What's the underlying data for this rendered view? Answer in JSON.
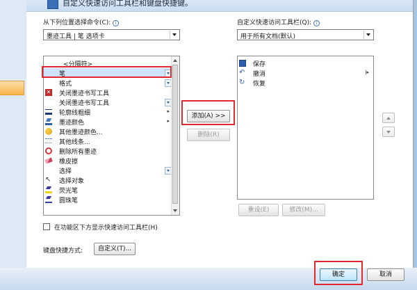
{
  "dialog": {
    "title": "自定义快速访问工具栏和键盘快捷键。"
  },
  "left_column": {
    "label": "从下列位置选择命令(C):",
    "combo_value": "墨迹工具 | 笔 选项卡",
    "items": [
      {
        "label": "<分隔符>",
        "icon": "separator"
      },
      {
        "label": "笔",
        "icon": "none",
        "extra": "dropdown-icon"
      },
      {
        "label": "格式",
        "icon": "none",
        "extra": "dropdown-icon"
      },
      {
        "label": "关闭墨迹书写工具",
        "icon": "close-red-icon"
      },
      {
        "label": "关闭墨迹书写工具",
        "icon": "none",
        "extra": "dropdown-icon"
      },
      {
        "label": "轮廓线粗细",
        "icon": "line-weight-icon",
        "extra": "submenu"
      },
      {
        "label": "墨迹颜色",
        "icon": "pen-color-icon",
        "extra": "submenu"
      },
      {
        "label": "其他墨迹颜色...",
        "icon": "palette-icon"
      },
      {
        "label": "其他线条...",
        "icon": "lines-icon"
      },
      {
        "label": "删除所有墨迹",
        "icon": "delete-ink-icon"
      },
      {
        "label": "橡皮擦",
        "icon": "eraser-icon"
      },
      {
        "label": "选择",
        "icon": "none",
        "extra": "dropdown-icon"
      },
      {
        "label": "选择对象",
        "icon": "cursor-icon"
      },
      {
        "label": "荧光笔",
        "icon": "highlighter-icon"
      },
      {
        "label": "圆珠笔",
        "icon": "ballpoint-icon"
      }
    ]
  },
  "right_column": {
    "label": "自定义快速访问工具栏(Q):",
    "combo_value": "用于所有文档(默认)",
    "items": [
      {
        "label": "保存",
        "icon": "save-icon"
      },
      {
        "label": "撤消",
        "icon": "undo-icon"
      },
      {
        "label": "恢复",
        "icon": "redo-icon"
      }
    ],
    "modify_label": "修改(M)...",
    "reset_label": "重设(E)"
  },
  "middle": {
    "add_label": "添加(A) >>",
    "remove_label": "删除(R)"
  },
  "options": {
    "checkbox_label": "在功能区下方显示快速访问工具栏(H)",
    "shortcut_label": "键盘快捷方式:",
    "customize_label": "自定义(T)..."
  },
  "footer": {
    "ok_label": "确定",
    "cancel_label": "取消"
  },
  "colors": {
    "highlight_red": "#e0282e"
  }
}
